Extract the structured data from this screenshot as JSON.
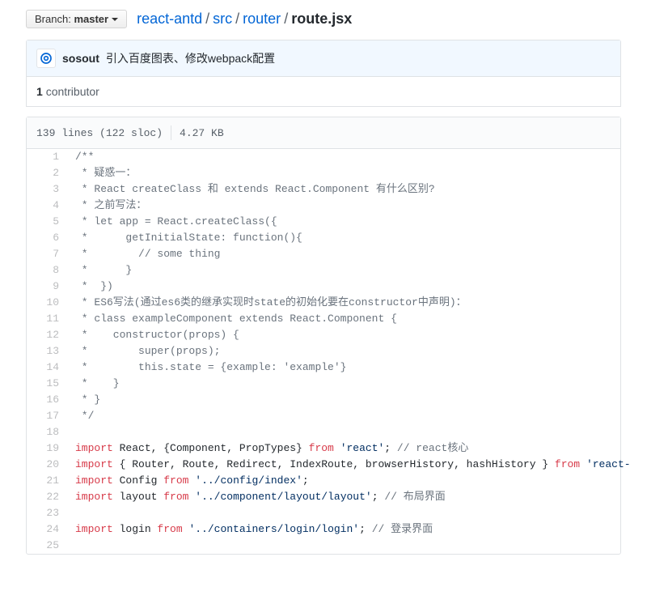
{
  "branch": {
    "label": "Branch:",
    "name": "master"
  },
  "breadcrumb": {
    "repo": "react-antd",
    "parts": [
      "src",
      "router"
    ],
    "file": "route.jsx"
  },
  "commit": {
    "author": "sosout",
    "message": "引入百度图表、修改webpack配置"
  },
  "contributors": {
    "count": "1",
    "label": "contributor"
  },
  "file_meta": {
    "lines": "139 lines (122 sloc)",
    "size": "4.27 KB"
  },
  "code_lines": [
    {
      "n": 1,
      "text": "/**",
      "cls": "pl-c"
    },
    {
      "n": 2,
      "text": " * 疑惑一：",
      "cls": "pl-c"
    },
    {
      "n": 3,
      "text": " * React createClass 和 extends React.Component 有什么区别?",
      "cls": "pl-c"
    },
    {
      "n": 4,
      "text": " * 之前写法：",
      "cls": "pl-c"
    },
    {
      "n": 5,
      "text": " * let app = React.createClass({",
      "cls": "pl-c"
    },
    {
      "n": 6,
      "text": " *      getInitialState: function(){",
      "cls": "pl-c"
    },
    {
      "n": 7,
      "text": " *        // some thing",
      "cls": "pl-c"
    },
    {
      "n": 8,
      "text": " *      }",
      "cls": "pl-c"
    },
    {
      "n": 9,
      "text": " *  })",
      "cls": "pl-c"
    },
    {
      "n": 10,
      "text": " * ES6写法(通过es6类的继承实现时state的初始化要在constructor中声明)：",
      "cls": "pl-c"
    },
    {
      "n": 11,
      "text": " * class exampleComponent extends React.Component {",
      "cls": "pl-c"
    },
    {
      "n": 12,
      "text": " *    constructor(props) {",
      "cls": "pl-c"
    },
    {
      "n": 13,
      "text": " *        super(props);",
      "cls": "pl-c"
    },
    {
      "n": 14,
      "text": " *        this.state = {example: 'example'}",
      "cls": "pl-c"
    },
    {
      "n": 15,
      "text": " *    }",
      "cls": "pl-c"
    },
    {
      "n": 16,
      "text": " * }",
      "cls": "pl-c"
    },
    {
      "n": 17,
      "text": " */",
      "cls": "pl-c"
    },
    {
      "n": 18,
      "text": "",
      "cls": ""
    },
    {
      "n": 19,
      "tokens": [
        {
          "t": "import",
          "c": "pl-k"
        },
        {
          "t": " React, {Component, PropTypes} ",
          "c": ""
        },
        {
          "t": "from",
          "c": "pl-k"
        },
        {
          "t": " ",
          "c": ""
        },
        {
          "t": "'react'",
          "c": "pl-s"
        },
        {
          "t": "; ",
          "c": ""
        },
        {
          "t": "// react核心",
          "c": "pl-c"
        }
      ]
    },
    {
      "n": 20,
      "tokens": [
        {
          "t": "import",
          "c": "pl-k"
        },
        {
          "t": " { Router, Route, Redirect, IndexRoute, browserHistory, hashHistory } ",
          "c": ""
        },
        {
          "t": "from",
          "c": "pl-k"
        },
        {
          "t": " ",
          "c": ""
        },
        {
          "t": "'react-",
          "c": "pl-s"
        }
      ]
    },
    {
      "n": 21,
      "tokens": [
        {
          "t": "import",
          "c": "pl-k"
        },
        {
          "t": " Config ",
          "c": ""
        },
        {
          "t": "from",
          "c": "pl-k"
        },
        {
          "t": " ",
          "c": ""
        },
        {
          "t": "'../config/index'",
          "c": "pl-s"
        },
        {
          "t": ";",
          "c": ""
        }
      ]
    },
    {
      "n": 22,
      "tokens": [
        {
          "t": "import",
          "c": "pl-k"
        },
        {
          "t": " layout ",
          "c": ""
        },
        {
          "t": "from",
          "c": "pl-k"
        },
        {
          "t": " ",
          "c": ""
        },
        {
          "t": "'../component/layout/layout'",
          "c": "pl-s"
        },
        {
          "t": "; ",
          "c": ""
        },
        {
          "t": "// 布局界面",
          "c": "pl-c"
        }
      ]
    },
    {
      "n": 23,
      "text": "",
      "cls": ""
    },
    {
      "n": 24,
      "tokens": [
        {
          "t": "import",
          "c": "pl-k"
        },
        {
          "t": " login ",
          "c": ""
        },
        {
          "t": "from",
          "c": "pl-k"
        },
        {
          "t": " ",
          "c": ""
        },
        {
          "t": "'../containers/login/login'",
          "c": "pl-s"
        },
        {
          "t": "; ",
          "c": ""
        },
        {
          "t": "// 登录界面",
          "c": "pl-c"
        }
      ]
    },
    {
      "n": 25,
      "text": "",
      "cls": ""
    }
  ]
}
